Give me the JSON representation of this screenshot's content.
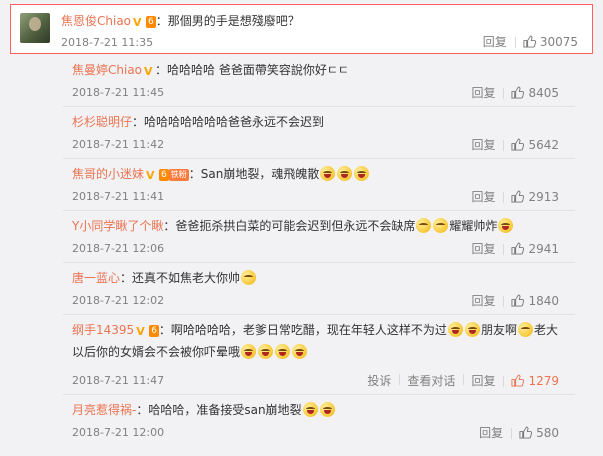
{
  "featured": {
    "username": "焦恩俊Chiao",
    "grade": "6",
    "text": "：那個男的手是想殘廢吧？",
    "time": "2018-7-21 11:35",
    "reply": "回复",
    "likes": "30075"
  },
  "comments": [
    {
      "username": "焦曼婷Chiao",
      "badge": "v",
      "text": "：哈哈哈哈 爸爸面帶笑容說你好ㄷㄷ",
      "time": "2018-7-21 11:45",
      "reply": "回复",
      "likes": "8405"
    },
    {
      "username": "杉杉聪明仔",
      "text": "：哈哈哈哈哈哈哈爸爸永远不会迟到",
      "time": "2018-7-21 11:42",
      "reply": "回复",
      "likes": "5642"
    },
    {
      "username": "焦哥的小迷妹",
      "badge": "v",
      "grade": "6",
      "fan": "铁粉",
      "text": "：San崩地裂，魂飛魄散",
      "emojis": 3,
      "time": "2018-7-21 11:41",
      "reply": "回复",
      "likes": "2913"
    },
    {
      "username": "Y小同学瞅了个瞅",
      "text": "：爸爸扼杀拱白菜的可能会迟到但永远不会缺席",
      "text2": "耀耀帅炸",
      "time": "2018-7-21 12:06",
      "reply": "回复",
      "likes": "2941"
    },
    {
      "username": "唐一蓝心",
      "text": "：还真不如焦老大你帅",
      "time": "2018-7-21 12:02",
      "reply": "回复",
      "likes": "1840"
    },
    {
      "username": "纲手14395",
      "badge": "v",
      "grade": "6",
      "text": "：啊哈哈哈哈，老爹日常吃醋，现在年轻人这样不为过",
      "text2": "朋友啊",
      "text3": "老大",
      "line2": "以后你的女婿会不会被你吓晕哦",
      "time": "2018-7-21 11:47",
      "report": "投诉",
      "view": "查看对话",
      "reply": "回复",
      "likes": "1279"
    },
    {
      "username": "月亮惹得祸-",
      "text": "：哈哈哈，准备接受san崩地裂",
      "time": "2018-7-21 12:00",
      "reply": "回复",
      "likes": "580"
    }
  ],
  "colors": {
    "username": "#eb7350",
    "meta": "#808080",
    "highlight_border": "#ff5f5f",
    "bg": "#f2f2f5"
  }
}
